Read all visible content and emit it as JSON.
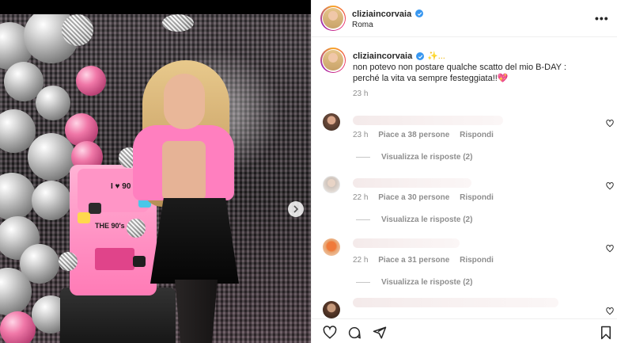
{
  "post": {
    "username": "cliziaincorvaia",
    "location": "Roma",
    "caption_user": "cliziaincorvaia",
    "caption_sparkle": "✨...",
    "caption_line1": "non potevo non postare qualche scatto del mio B-DAY :",
    "caption_line2": "perché la vita va sempre festeggiata!!",
    "caption_heart": "💖",
    "caption_time": "23 h"
  },
  "media": {
    "cake_text_1": "I ♥ 90",
    "cake_text_2": "THE 90's",
    "next_icon": "chevron-right-icon"
  },
  "comments": [
    {
      "time": "23 h",
      "likes": "Piace a 38 persone",
      "reply": "Rispondi",
      "view_replies": "Visualizza le risposte (2)"
    },
    {
      "time": "22 h",
      "likes": "Piace a 30 persone",
      "reply": "Rispondi",
      "view_replies": "Visualizza le risposte (2)"
    },
    {
      "time": "22 h",
      "likes": "Piace a 31 persone",
      "reply": "Rispondi",
      "view_replies": "Visualizza le risposte (2)"
    }
  ],
  "header": {
    "more_label": "•••"
  },
  "colors": {
    "verified": "#3897f0",
    "secondary_text": "#8e8e8e",
    "accent_pink": "#ff7fbf"
  },
  "actions": {
    "icons": [
      "heart-icon",
      "comment-icon",
      "share-icon",
      "bookmark-icon"
    ]
  }
}
